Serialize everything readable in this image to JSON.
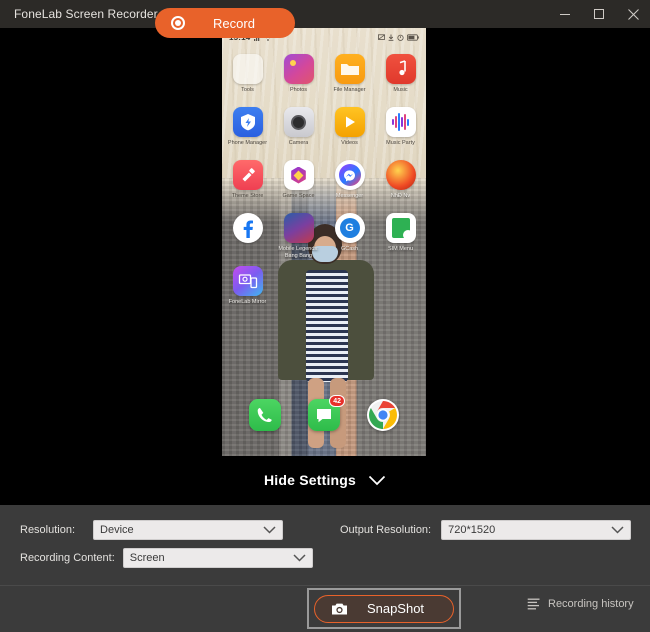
{
  "window": {
    "title": "FoneLab Screen Recorder",
    "controls": [
      {
        "name": "minimize",
        "glyph": "minimize-icon"
      },
      {
        "name": "maximize",
        "glyph": "maximize-icon"
      },
      {
        "name": "close",
        "glyph": "close-icon"
      }
    ]
  },
  "phone": {
    "statusbar": {
      "time": "15:14",
      "left_icons": [
        "signal-icon",
        "wifi-icon"
      ],
      "right_icons": [
        "screencast-icon",
        "download-icon",
        "alarm-icon",
        "battery-icon"
      ]
    },
    "rows": [
      [
        {
          "label": "Tools",
          "icon": "tools-folder-icon"
        },
        {
          "label": "Photos",
          "icon": "photos-icon"
        },
        {
          "label": "File Manager",
          "icon": "file-manager-icon"
        },
        {
          "label": "Music",
          "icon": "music-icon"
        }
      ],
      [
        {
          "label": "Phone Manager",
          "icon": "phone-manager-icon"
        },
        {
          "label": "Camera",
          "icon": "camera-icon"
        },
        {
          "label": "Videos",
          "icon": "videos-icon"
        },
        {
          "label": "Music Party",
          "icon": "music-party-icon"
        }
      ],
      [
        {
          "label": "Theme Store",
          "icon": "theme-store-icon"
        },
        {
          "label": "Game Space",
          "icon": "game-space-icon"
        },
        {
          "label": "Messenger",
          "icon": "messenger-icon"
        },
        {
          "label": "NhĐ Nv",
          "icon": "nhanv-icon"
        }
      ],
      [
        {
          "label": "",
          "icon": "facebook-icon"
        },
        {
          "label": "Mobile Legends: Bang Bang",
          "icon": "mobile-legends-icon"
        },
        {
          "label": "GCash",
          "icon": "gcash-icon"
        },
        {
          "label": "SIM Menu",
          "icon": "sim-menu-icon"
        }
      ],
      [
        {
          "label": "FoneLab Mirror",
          "icon": "fonelab-mirror-icon"
        }
      ]
    ],
    "dock": [
      {
        "label": "Phone",
        "icon": "phone-dial-icon",
        "badge": ""
      },
      {
        "label": "Messages",
        "icon": "messages-icon",
        "badge": "42"
      },
      {
        "label": "Chrome",
        "icon": "chrome-icon",
        "badge": ""
      }
    ]
  },
  "hide_settings": {
    "label": "Hide Settings",
    "chevron": "chevron-down-icon"
  },
  "settings": {
    "resolution": {
      "label": "Resolution:",
      "value": "Device"
    },
    "recording_content": {
      "label": "Recording Content:",
      "value": "Screen"
    },
    "output_resolution": {
      "label": "Output Resolution:",
      "value": "720*1520"
    }
  },
  "bottom": {
    "record_label": "Record",
    "snapshot_label": "SnapShot",
    "recording_history_label": "Recording history"
  },
  "colors": {
    "accent": "#e8622a",
    "titlebar": "#2c2a27",
    "panel": "#3b3b3b",
    "badge": "#e8302a"
  }
}
